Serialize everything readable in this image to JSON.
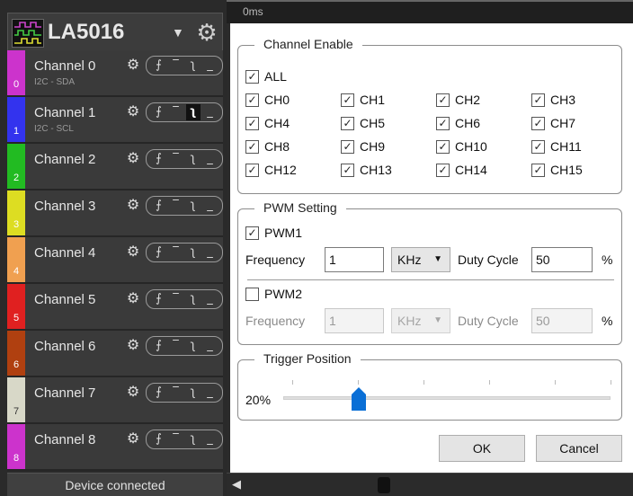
{
  "device": {
    "name": "LA5016"
  },
  "channels": [
    {
      "label": "Channel 0",
      "number": "0",
      "protocol": "I2C - SDA",
      "color": "#cc33cc"
    },
    {
      "label": "Channel 1",
      "number": "1",
      "protocol": "I2C - SCL",
      "color": "#3333ee"
    },
    {
      "label": "Channel 2",
      "number": "2",
      "protocol": "",
      "color": "#22bb22"
    },
    {
      "label": "Channel 3",
      "number": "3",
      "protocol": "",
      "color": "#dddd22"
    },
    {
      "label": "Channel 4",
      "number": "4",
      "protocol": "",
      "color": "#f0a050"
    },
    {
      "label": "Channel 5",
      "number": "5",
      "protocol": "",
      "color": "#e02020"
    },
    {
      "label": "Channel 6",
      "number": "6",
      "protocol": "",
      "color": "#b04010"
    },
    {
      "label": "Channel 7",
      "number": "7",
      "protocol": "",
      "color": "#d8d8c8"
    },
    {
      "label": "Channel 8",
      "number": "8",
      "protocol": "",
      "color": "#cc33cc"
    }
  ],
  "status": {
    "text": "Device connected"
  },
  "timeline": {
    "label": "0ms"
  },
  "channel_enable": {
    "title": "Channel Enable",
    "all_label": "ALL",
    "items": [
      "CH0",
      "CH1",
      "CH2",
      "CH3",
      "CH4",
      "CH5",
      "CH6",
      "CH7",
      "CH8",
      "CH9",
      "CH10",
      "CH11",
      "CH12",
      "CH13",
      "CH14",
      "CH15"
    ]
  },
  "pwm": {
    "title": "PWM Setting",
    "pwm1": {
      "label": "PWM1",
      "checked": true,
      "frequency_label": "Frequency",
      "frequency": "1",
      "unit": "KHz",
      "duty_label": "Duty Cycle",
      "duty": "50",
      "percent": "%"
    },
    "pwm2": {
      "label": "PWM2",
      "checked": false,
      "frequency_label": "Frequency",
      "frequency": "1",
      "unit": "KHz",
      "duty_label": "Duty Cycle",
      "duty": "50",
      "percent": "%"
    }
  },
  "trigger": {
    "title": "Trigger Position",
    "value": "20%"
  },
  "buttons": {
    "ok": "OK",
    "cancel": "Cancel"
  }
}
